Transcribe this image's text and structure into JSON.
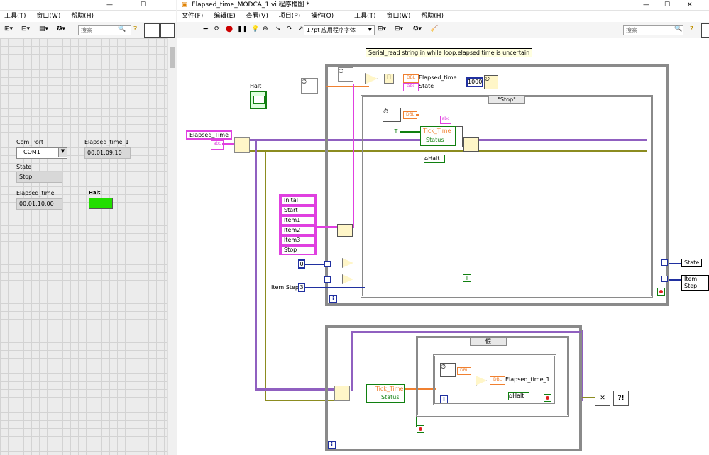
{
  "front_panel": {
    "menu": [
      "工具(T)",
      "窗口(W)",
      "帮助(H)"
    ],
    "search_placeholder": "搜索",
    "com_port": {
      "label": "Com_Port",
      "value": "COM1"
    },
    "elapsed_time_1": {
      "label": "Elapsed_time_1",
      "value": "00:01:09.10"
    },
    "state": {
      "label": "State",
      "value": "Stop"
    },
    "elapsed_time": {
      "label": "Elapsed_time",
      "value": "00:01:10.00"
    },
    "halt": {
      "label": "Halt",
      "color": "#22dd00"
    }
  },
  "block_diagram": {
    "title": "Elapsed_time_MODCA_1.vi 程序框图 *",
    "menu": [
      "文件(F)",
      "编辑(E)",
      "查看(V)",
      "项目(P)",
      "操作(O)",
      "工具(T)",
      "窗口(W)",
      "帮助(H)"
    ],
    "font_select": "17pt 应用程序字体",
    "search_placeholder": "搜索",
    "comment": "Serial_read string in while loop,elapsed time is uncertain",
    "halt_label": "Halt",
    "elapsed_time_cluster": "Elapsed_Time",
    "elapsed_time_out": "Elapsed_time",
    "state_out": "State",
    "const_1000": "1000",
    "case_stop": "\"Stop\"",
    "case_false": "假",
    "tick_time": "Tick_Time",
    "status": "Status",
    "halt_ref": "Halt",
    "enum_items": [
      "Inital",
      "Start",
      "Item1",
      "Item2",
      "Item3",
      "Stop"
    ],
    "const_0": "0",
    "item_steps_label": "Item Steps",
    "const_3": "3",
    "state_indicator": "State",
    "item_step_indicator": "Item Step",
    "elapsed_time_1_out": "Elapsed_time_1",
    "dbl": "DBL",
    "tf_true": "T",
    "iter": "i",
    "colors": {
      "pink_wire": "#e040e0",
      "purple_wire": "#9060c0",
      "olive_wire": "#8c8c20",
      "orange_wire": "#f08030",
      "green_wire": "#108010"
    }
  }
}
